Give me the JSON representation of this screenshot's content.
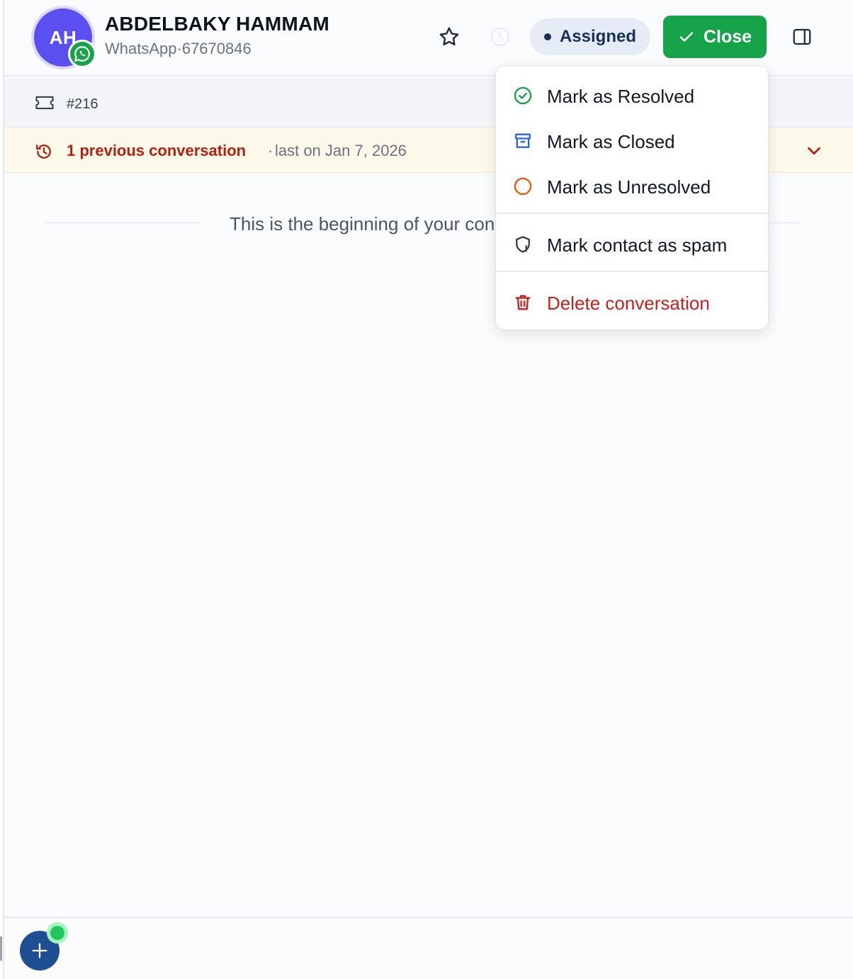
{
  "contact": {
    "initials": "AH",
    "name": "ABDELBAKY HAMMAM",
    "channel": "WhatsApp",
    "separator": "·",
    "phone": "67670846"
  },
  "header": {
    "star_icon": "star-icon",
    "snooze_icon": "clock-icon",
    "status_label": "Assigned",
    "close_label": "Close",
    "panel_icon": "sidebar-panel-icon"
  },
  "ticket": {
    "id": "#216",
    "icon": "ticket-icon"
  },
  "previous": {
    "count_label": "1 previous conversation",
    "separator": "·",
    "last_on": "last on Jan 7, 2026",
    "icon": "history-icon",
    "chevron": "chevron-down-icon"
  },
  "thread": {
    "beginning_text": "This is the beginning of your conversation",
    "icon": "whatsapp-icon"
  },
  "menu": {
    "items": [
      {
        "label": "Mark as Resolved",
        "icon": "check-circle-icon"
      },
      {
        "label": "Mark as Closed",
        "icon": "archive-icon"
      },
      {
        "label": "Mark as Unresolved",
        "icon": "circle-icon"
      },
      {
        "label": "Mark contact as spam",
        "icon": "shield-alert-icon"
      },
      {
        "label": "Delete conversation",
        "icon": "trash-icon"
      }
    ]
  },
  "colors": {
    "accent_green": "#16a34a",
    "avatar": "#5b4ff0",
    "danger": "#c81e1e",
    "status_pill": "#e6ecf5",
    "banner": "#fdf9ea"
  }
}
